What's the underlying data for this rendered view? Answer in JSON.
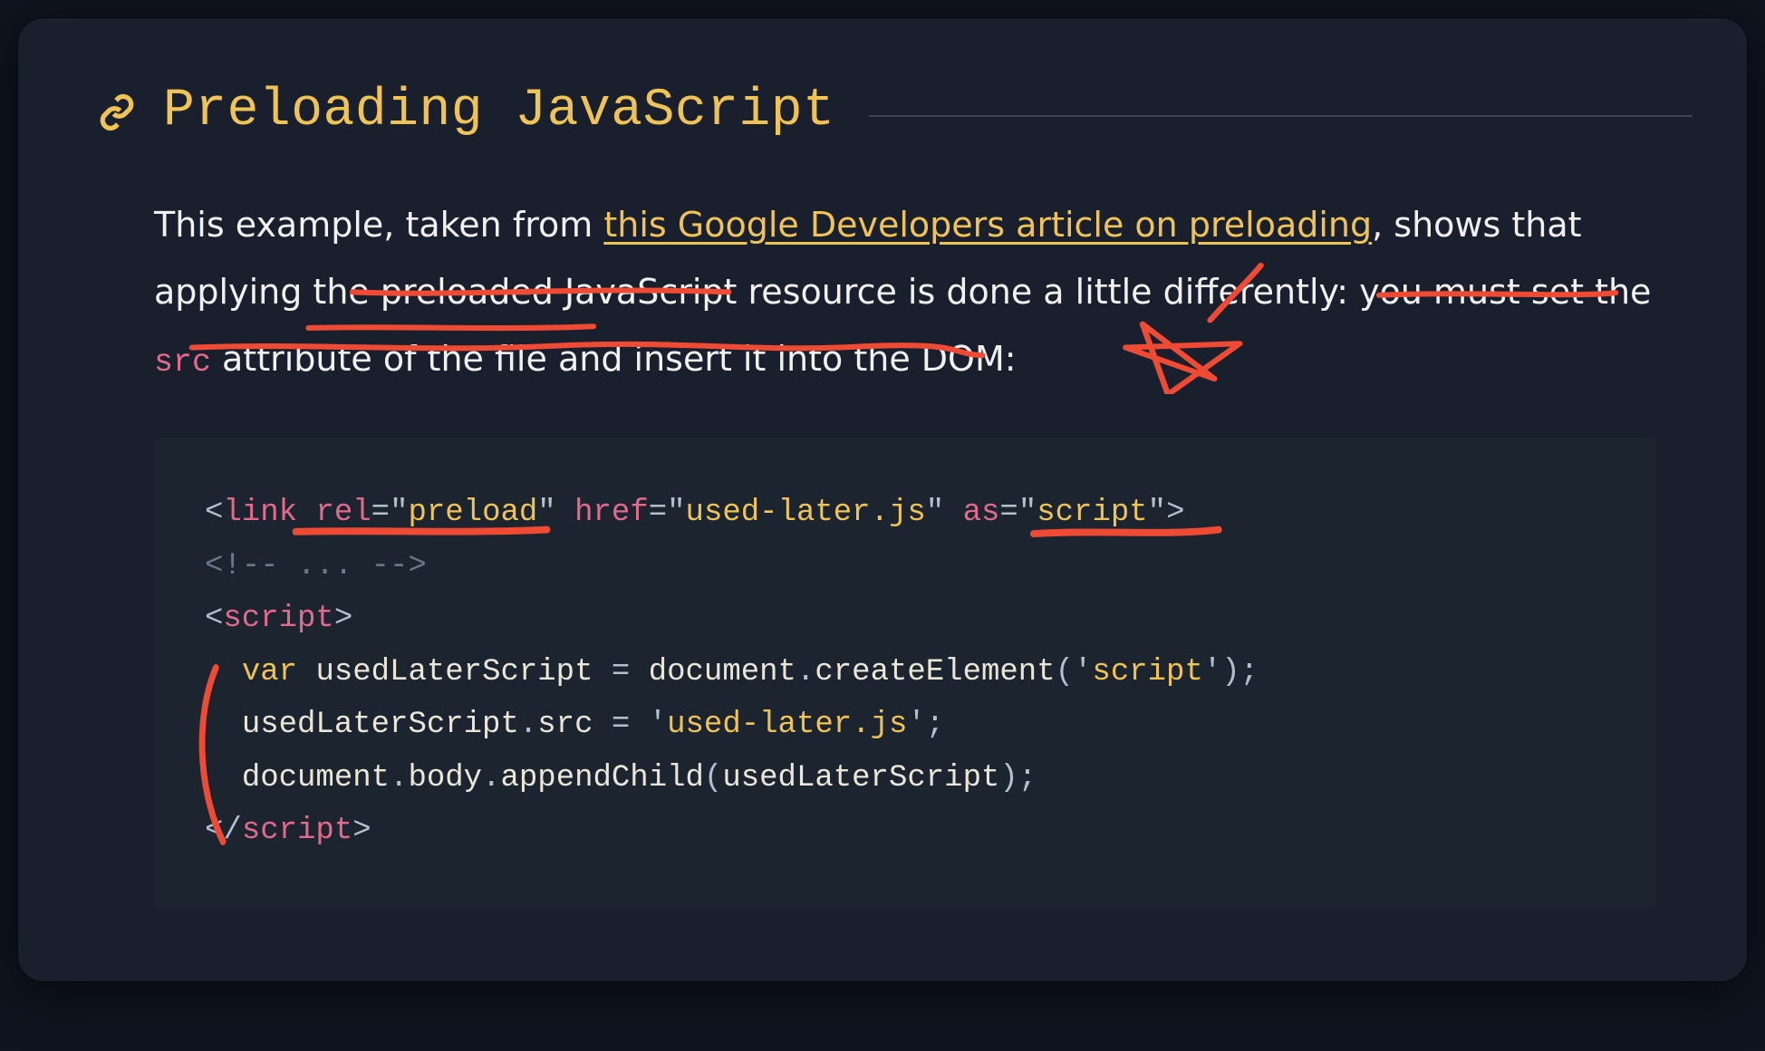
{
  "heading": "Preloading JavaScript",
  "paragraph": {
    "t1": "This example, taken from ",
    "link_text": "this Google Developers article on preloading",
    "t2": ", shows that applying the preloaded JavaScript resource is done a little differently: you must set the ",
    "code": "src",
    "t3": " attribute of the file and insert it into the DOM:"
  },
  "code_tokens": {
    "l1_open": "<",
    "l1_tag": "link",
    "l1_sp": " ",
    "l1_rel": "rel",
    "l1_eq1": "=",
    "l1_q1a": "\"",
    "l1_v1": "preload",
    "l1_q1b": "\"",
    "l1_sp2": " ",
    "l1_href": "href",
    "l1_eq2": "=",
    "l1_q2a": "\"",
    "l1_v2": "used-later.js",
    "l1_q2b": "\"",
    "l1_sp3": " ",
    "l1_as": "as",
    "l1_eq3": "=",
    "l1_q3a": "\"",
    "l1_v3": "script",
    "l1_q3b": "\"",
    "l1_close": ">",
    "l2": "<!-- ... -->",
    "l3_open": "<",
    "l3_tag": "script",
    "l3_close": ">",
    "l4_indent": "  ",
    "l4_var": "var",
    "l4_sp": " ",
    "l4_name": "usedLaterScript",
    "l4_sp2": " ",
    "l4_eq": "=",
    "l4_sp3": " ",
    "l4_doc": "document",
    "l4_dot": ".",
    "l4_fn": "createElement",
    "l4_lp": "(",
    "l4_q1": "'",
    "l4_arg": "script",
    "l4_q2": "'",
    "l4_rp": ")",
    "l4_semi": ";",
    "l5_indent": "  ",
    "l5_name": "usedLaterScript",
    "l5_dot": ".",
    "l5_prop": "src",
    "l5_sp": " ",
    "l5_eq": "=",
    "l5_sp2": " ",
    "l5_q1": "'",
    "l5_val": "used-later.js",
    "l5_q2": "'",
    "l5_semi": ";",
    "l6_indent": "  ",
    "l6_doc": "document",
    "l6_dot1": ".",
    "l6_body": "body",
    "l6_dot2": ".",
    "l6_fn": "appendChild",
    "l6_lp": "(",
    "l6_arg": "usedLaterScript",
    "l6_rp": ")",
    "l6_semi": ";",
    "l7_open": "</",
    "l7_tag": "script",
    "l7_close": ">"
  }
}
